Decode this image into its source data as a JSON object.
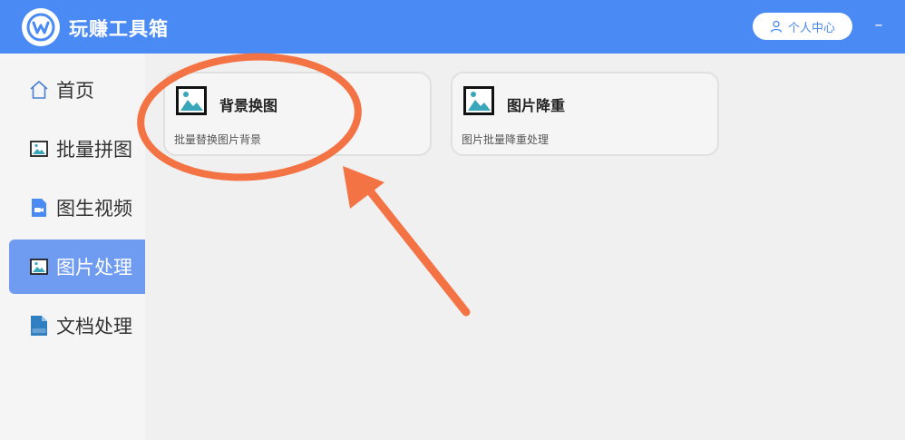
{
  "app": {
    "title": "玩赚工具箱"
  },
  "header": {
    "user_center_label": "个人中心",
    "minimize_label": "–"
  },
  "sidebar": {
    "items": [
      {
        "label": "首页",
        "icon": "home-icon"
      },
      {
        "label": "批量拼图",
        "icon": "image-icon"
      },
      {
        "label": "图生视频",
        "icon": "video-file-icon"
      },
      {
        "label": "图片处理",
        "icon": "image-icon",
        "active": true
      },
      {
        "label": "文档处理",
        "icon": "doc-file-icon"
      }
    ]
  },
  "cards": [
    {
      "title": "背景换图",
      "description": "批量替换图片背景",
      "icon": "picture-icon"
    },
    {
      "title": "图片降重",
      "description": "图片批量降重处理",
      "icon": "picture-icon"
    }
  ],
  "colors": {
    "header": "#4a8af4",
    "active_nav": "#6f9cf0",
    "annotation": "#f47344"
  }
}
